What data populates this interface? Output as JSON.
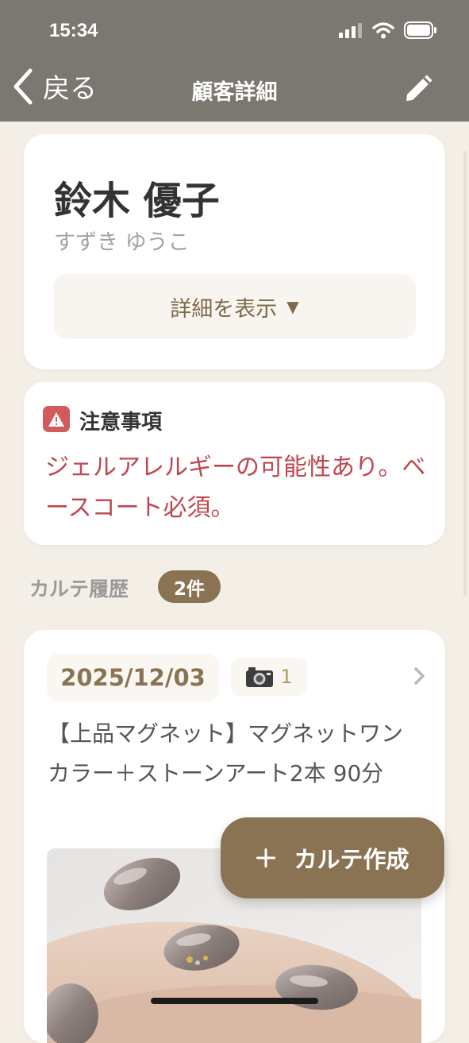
{
  "status_bar": {
    "time": "15:34"
  },
  "nav": {
    "back_label": "戻る",
    "title": "顧客詳細"
  },
  "customer": {
    "name": "鈴木 優子",
    "kana": "すずき ゆうこ",
    "details_button": "詳細を表示",
    "details_arrow": "▼"
  },
  "warning": {
    "title": "注意事項",
    "message": "ジェルアレルギーの可能性あり。ベースコート必須。"
  },
  "history": {
    "label": "カルテ履歴",
    "count": "2件",
    "records": [
      {
        "date": "2025/12/03",
        "photo_count": "1",
        "description": "【上品マグネット】マグネットワンカラー＋ストーンアート2本 90分"
      }
    ]
  },
  "fab": {
    "icon": "＋",
    "label": "カルテ作成"
  },
  "icons": {
    "back": "chevron-left-icon",
    "edit": "pencil-icon",
    "warning": "warning-icon",
    "camera": "camera-icon",
    "chevron": "chevron-right-icon"
  },
  "colors": {
    "header": "#7b7771",
    "background": "#f3efe7",
    "accent": "#8a7352",
    "warning": "#c0464e"
  }
}
